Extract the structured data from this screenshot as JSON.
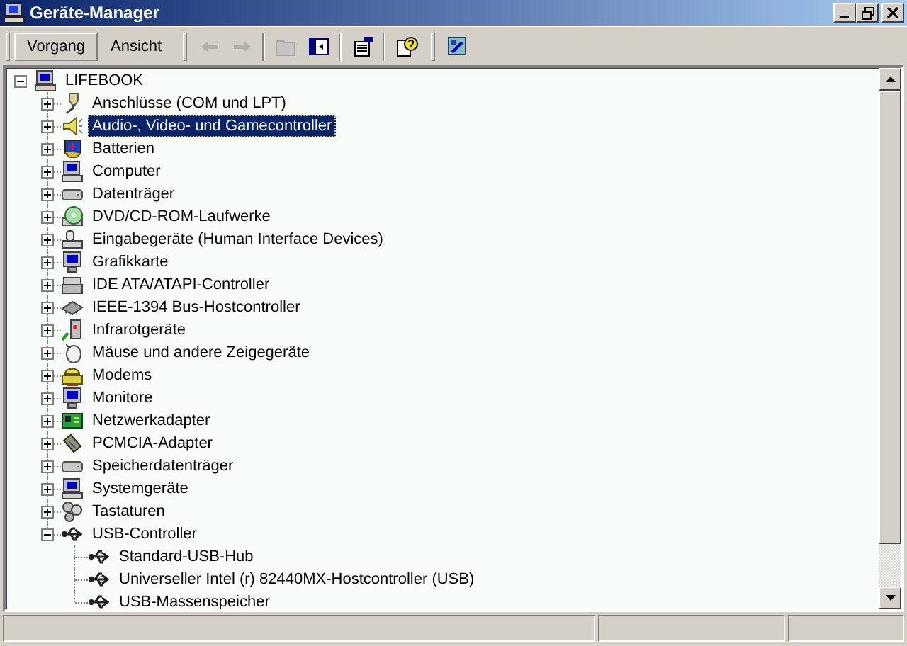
{
  "window": {
    "title": "Geräte-Manager"
  },
  "toolbar": {
    "menus": [
      "Vorgang",
      "Ansicht"
    ],
    "buttons": [
      {
        "disabled": true
      },
      {
        "disabled": true
      },
      {
        "disabled": true
      },
      {
        "disabled": false
      },
      {
        "disabled": false
      },
      {
        "disabled": false
      },
      {
        "disabled": false
      }
    ]
  },
  "tree": {
    "label": "LIFEBOOK",
    "expanded": true,
    "selected": false,
    "children": [
      {
        "label": "Anschlüsse (COM und LPT)",
        "expanded": false,
        "selected": false
      },
      {
        "label": "Audio-, Video- und Gamecontroller",
        "expanded": false,
        "selected": true
      },
      {
        "label": "Batterien",
        "expanded": false,
        "selected": false
      },
      {
        "label": "Computer",
        "expanded": false,
        "selected": false
      },
      {
        "label": "Datenträger",
        "expanded": false,
        "selected": false
      },
      {
        "label": "DVD/CD-ROM-Laufwerke",
        "expanded": false,
        "selected": false
      },
      {
        "label": "Eingabegeräte (Human Interface Devices)",
        "expanded": false,
        "selected": false
      },
      {
        "label": "Grafikkarte",
        "expanded": false,
        "selected": false
      },
      {
        "label": "IDE ATA/ATAPI-Controller",
        "expanded": false,
        "selected": false
      },
      {
        "label": "IEEE-1394 Bus-Hostcontroller",
        "expanded": false,
        "selected": false
      },
      {
        "label": "Infrarotgeräte",
        "expanded": false,
        "selected": false
      },
      {
        "label": "Mäuse und andere Zeigegeräte",
        "expanded": false,
        "selected": false
      },
      {
        "label": "Modems",
        "expanded": false,
        "selected": false
      },
      {
        "label": "Monitore",
        "expanded": false,
        "selected": false
      },
      {
        "label": "Netzwerkadapter",
        "expanded": false,
        "selected": false
      },
      {
        "label": "PCMCIA-Adapter",
        "expanded": false,
        "selected": false
      },
      {
        "label": "Speicherdatenträger",
        "expanded": false,
        "selected": false
      },
      {
        "label": "Systemgeräte",
        "expanded": false,
        "selected": false
      },
      {
        "label": "Tastaturen",
        "expanded": false,
        "selected": false
      },
      {
        "label": "USB-Controller",
        "expanded": true,
        "selected": false,
        "children": [
          {
            "label": "Standard-USB-Hub",
            "selected": false
          },
          {
            "label": "Universeller Intel (r) 82440MX-Hostcontroller (USB)",
            "selected": false
          },
          {
            "label": "USB-Massenspeicher",
            "selected": false
          }
        ]
      }
    ]
  }
}
